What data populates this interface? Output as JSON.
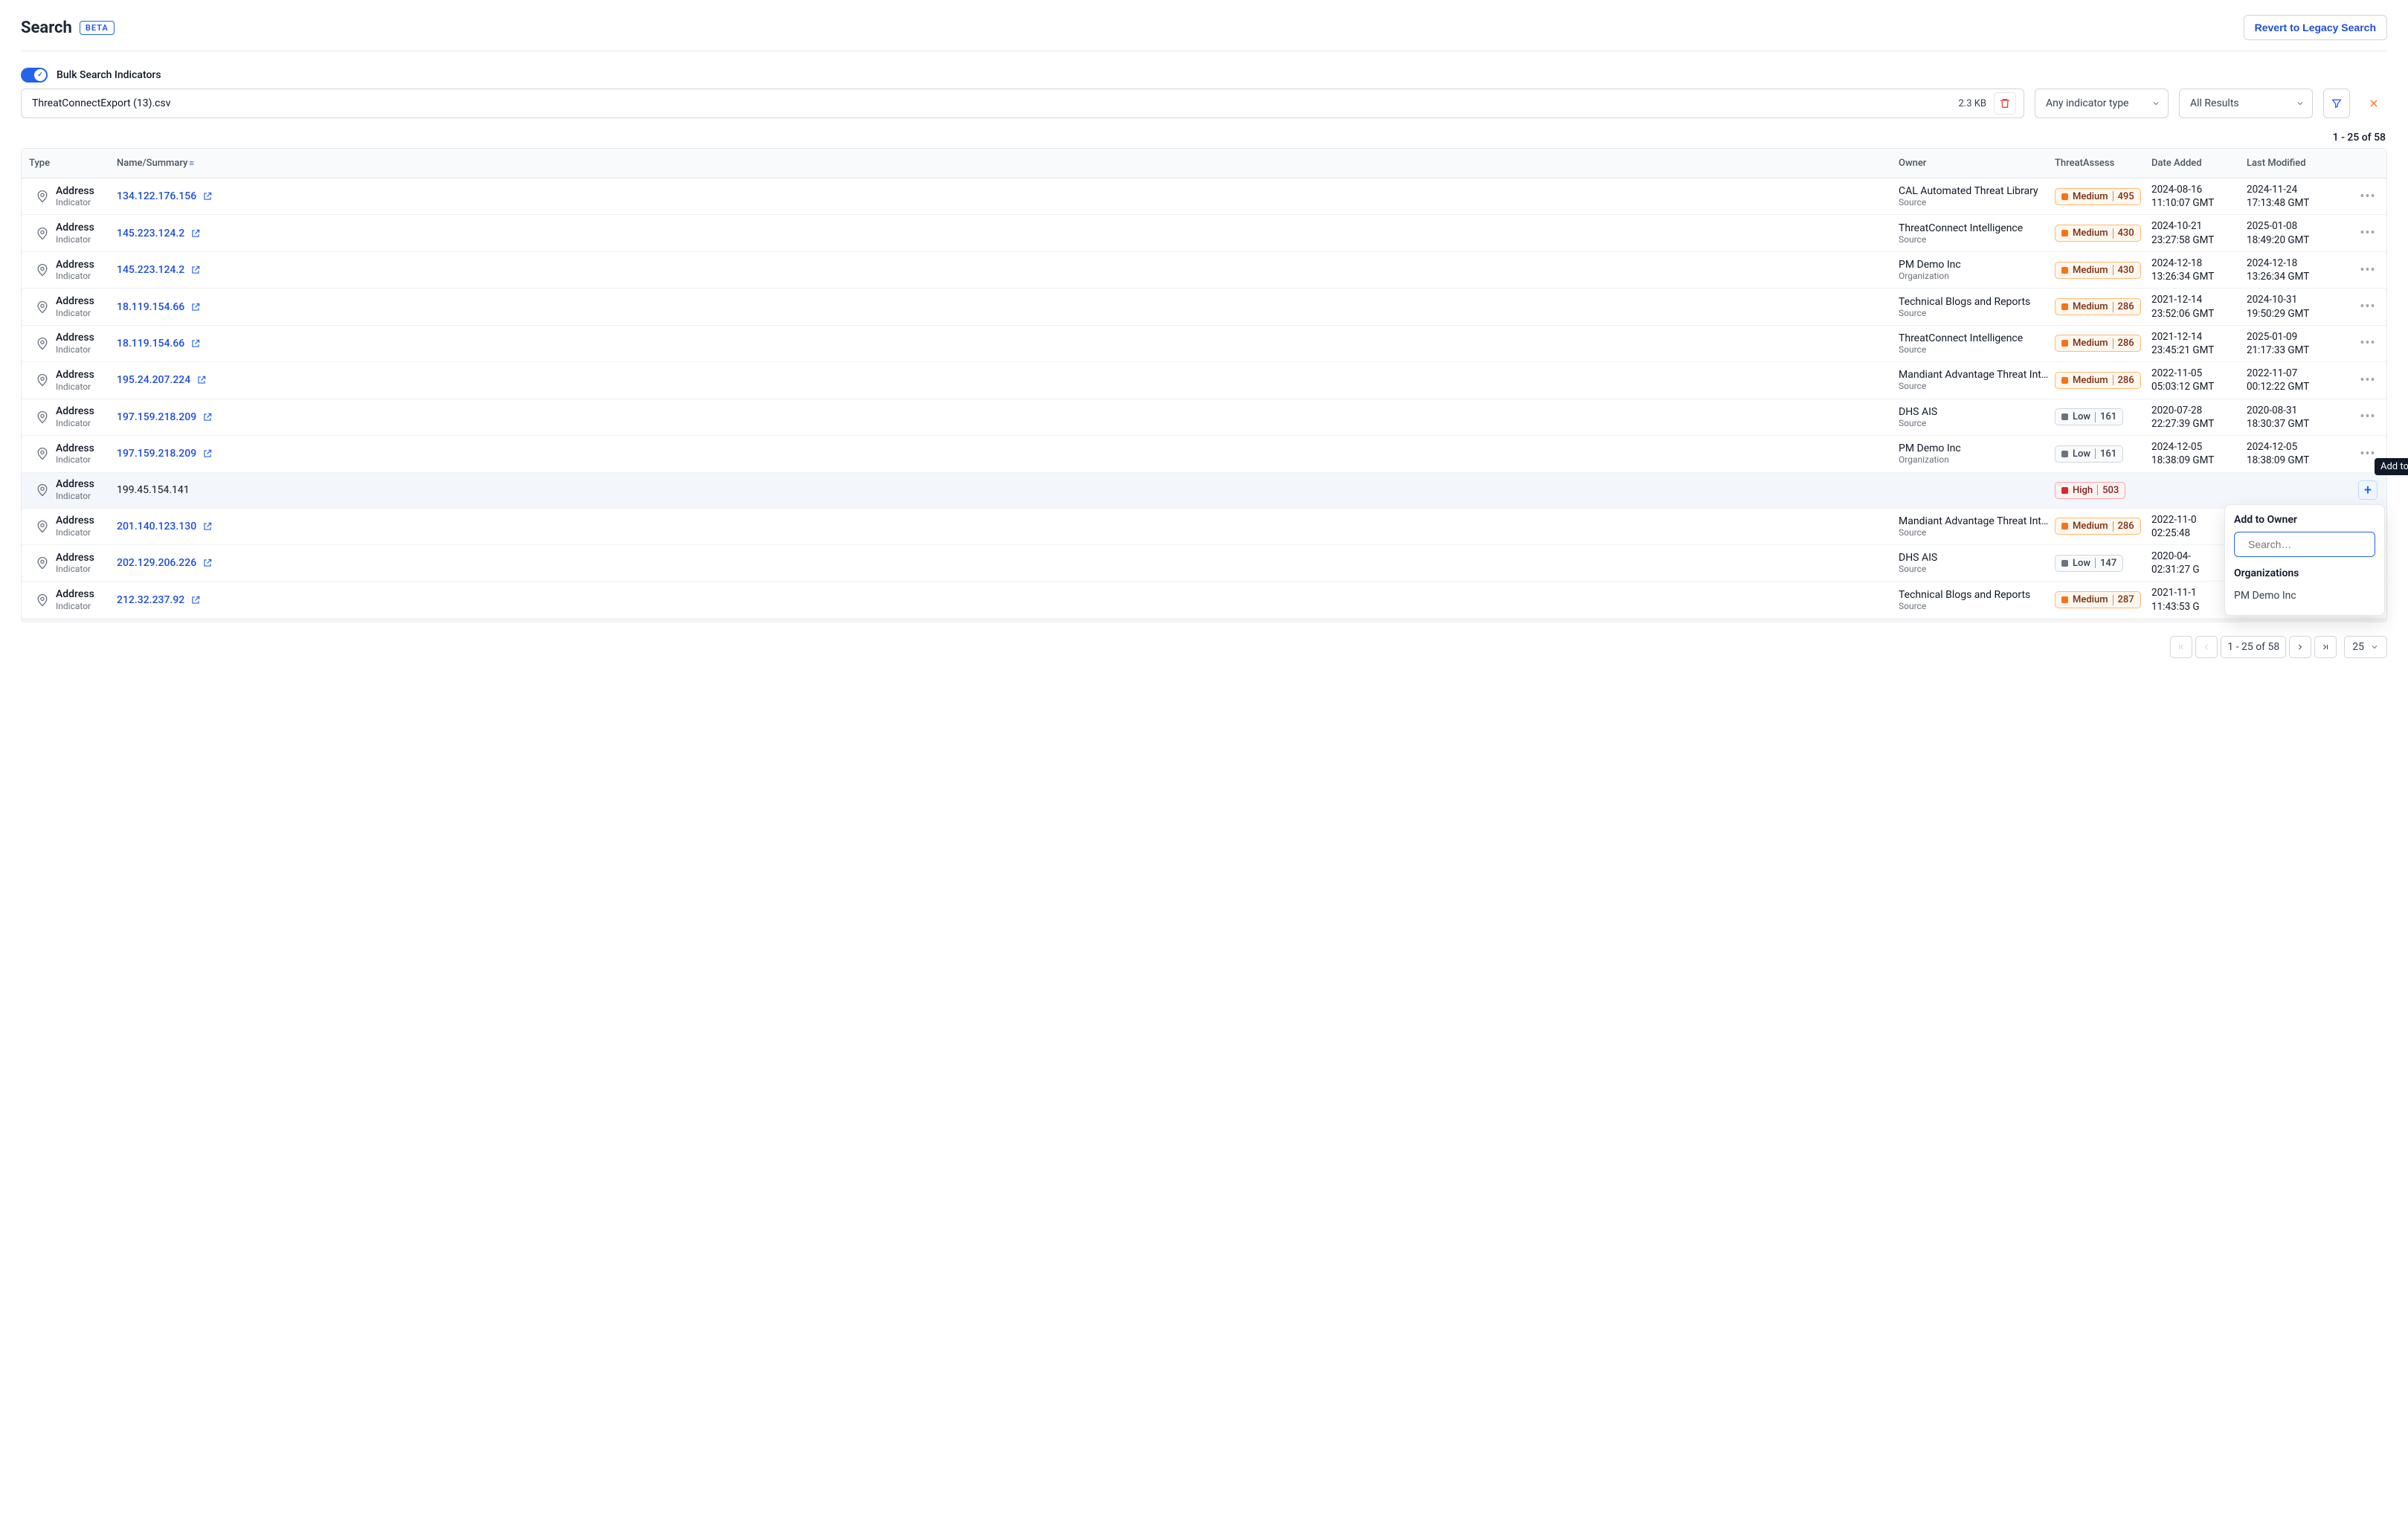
{
  "header": {
    "title": "Search",
    "badge": "BETA",
    "revert_label": "Revert to Legacy Search"
  },
  "bulk": {
    "toggle_label": "Bulk Search Indicators",
    "file_name": "ThreatConnectExport (13).csv",
    "file_size": "2.3 KB",
    "indicator_type": "Any indicator type",
    "results_filter": "All Results"
  },
  "results_summary": "1 - 25 of 58",
  "columns": {
    "type": "Type",
    "name": "Name/Summary",
    "owner": "Owner",
    "threat": "ThreatAssess",
    "added": "Date Added",
    "modified": "Last Modified"
  },
  "rows": [
    {
      "type": "Address",
      "sub": "Indicator",
      "name": "134.122.176.156",
      "link": true,
      "owner": "CAL Automated Threat Library",
      "owner_sub": "Source",
      "level": "Medium",
      "score": "495",
      "added_d": "2024-08-16",
      "added_t": "11:10:07 GMT",
      "mod_d": "2024-11-24",
      "mod_t": "17:13:48 GMT",
      "action": "dots"
    },
    {
      "type": "Address",
      "sub": "Indicator",
      "name": "145.223.124.2",
      "link": true,
      "owner": "ThreatConnect Intelligence",
      "owner_sub": "Source",
      "level": "Medium",
      "score": "430",
      "added_d": "2024-10-21",
      "added_t": "23:27:58 GMT",
      "mod_d": "2025-01-08",
      "mod_t": "18:49:20 GMT",
      "action": "dots"
    },
    {
      "type": "Address",
      "sub": "Indicator",
      "name": "145.223.124.2",
      "link": true,
      "owner": "PM Demo Inc",
      "owner_sub": "Organization",
      "level": "Medium",
      "score": "430",
      "added_d": "2024-12-18",
      "added_t": "13:26:34 GMT",
      "mod_d": "2024-12-18",
      "mod_t": "13:26:34 GMT",
      "action": "dots"
    },
    {
      "type": "Address",
      "sub": "Indicator",
      "name": "18.119.154.66",
      "link": true,
      "owner": "Technical Blogs and Reports",
      "owner_sub": "Source",
      "level": "Medium",
      "score": "286",
      "added_d": "2021-12-14",
      "added_t": "23:52:06 GMT",
      "mod_d": "2024-10-31",
      "mod_t": "19:50:29 GMT",
      "action": "dots"
    },
    {
      "type": "Address",
      "sub": "Indicator",
      "name": "18.119.154.66",
      "link": true,
      "owner": "ThreatConnect Intelligence",
      "owner_sub": "Source",
      "level": "Medium",
      "score": "286",
      "added_d": "2021-12-14",
      "added_t": "23:45:21 GMT",
      "mod_d": "2025-01-09",
      "mod_t": "21:17:33 GMT",
      "action": "dots"
    },
    {
      "type": "Address",
      "sub": "Indicator",
      "name": "195.24.207.224",
      "link": true,
      "owner": "Mandiant Advantage Threat Int…",
      "owner_sub": "Source",
      "level": "Medium",
      "score": "286",
      "added_d": "2022-11-05",
      "added_t": "05:03:12 GMT",
      "mod_d": "2022-11-07",
      "mod_t": "00:12:22 GMT",
      "action": "dots"
    },
    {
      "type": "Address",
      "sub": "Indicator",
      "name": "197.159.218.209",
      "link": true,
      "owner": "DHS AIS",
      "owner_sub": "Source",
      "level": "Low",
      "score": "161",
      "added_d": "2020-07-28",
      "added_t": "22:27:39 GMT",
      "mod_d": "2020-08-31",
      "mod_t": "18:30:37 GMT",
      "action": "dots"
    },
    {
      "type": "Address",
      "sub": "Indicator",
      "name": "197.159.218.209",
      "link": true,
      "owner": "PM Demo Inc",
      "owner_sub": "Organization",
      "level": "Low",
      "score": "161",
      "added_d": "2024-12-05",
      "added_t": "18:38:09 GMT",
      "mod_d": "2024-12-05",
      "mod_t": "18:38:09 GMT",
      "action": "dots"
    },
    {
      "type": "Address",
      "sub": "Indicator",
      "name": "199.45.154.141",
      "link": false,
      "owner": "",
      "owner_sub": "",
      "level": "High",
      "score": "503",
      "added_d": "",
      "added_t": "",
      "mod_d": "",
      "mod_t": "",
      "action": "plus",
      "highlight": true
    },
    {
      "type": "Address",
      "sub": "Indicator",
      "name": "201.140.123.130",
      "link": true,
      "owner": "Mandiant Advantage Threat Int…",
      "owner_sub": "Source",
      "level": "Medium",
      "score": "286",
      "added_d": "2022-11-0",
      "added_t": "02:25:48",
      "mod_d": "",
      "mod_t": "",
      "action": "none"
    },
    {
      "type": "Address",
      "sub": "Indicator",
      "name": "202.129.206.226",
      "link": true,
      "owner": "DHS AIS",
      "owner_sub": "Source",
      "level": "Low",
      "score": "147",
      "added_d": "2020-04-",
      "added_t": "02:31:27 G",
      "mod_d": "",
      "mod_t": "",
      "action": "none"
    },
    {
      "type": "Address",
      "sub": "Indicator",
      "name": "212.32.237.92",
      "link": true,
      "owner": "Technical Blogs and Reports",
      "owner_sub": "Source",
      "level": "Medium",
      "score": "287",
      "added_d": "2021-11-1",
      "added_t": "11:43:53 G",
      "mod_d": "",
      "mod_t": "",
      "action": "none"
    }
  ],
  "tooltip": {
    "text": "Add to Owner"
  },
  "popover": {
    "title": "Add to Owner",
    "search_placeholder": "Search…",
    "section": "Organizations",
    "items": [
      "PM Demo Inc"
    ]
  },
  "pagination": {
    "range_text": "1 - 25 of 58",
    "per_page": "25"
  }
}
